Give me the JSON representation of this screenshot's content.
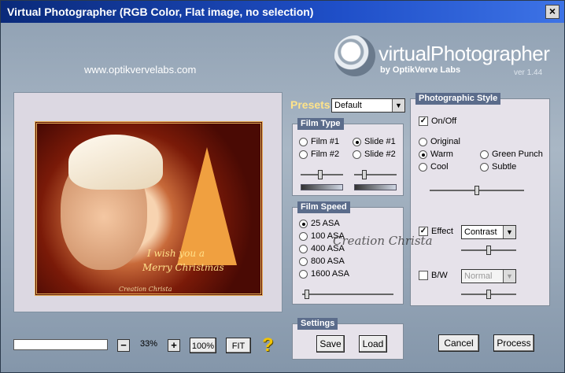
{
  "window": {
    "title": "Virtual Photographer (RGB Color, Flat image, no selection)",
    "close_label": "×"
  },
  "branding": {
    "website": "www.optikvervelabs.com",
    "logo_text": "virtualPhotographer",
    "logo_sub": "by OptikVerve Labs",
    "version": "ver 1.44"
  },
  "preview": {
    "caption_line1": "I wish you a",
    "caption_line2": "Merry Christmas",
    "credit": "Creation Christa",
    "zoom_minus": "−",
    "zoom_value": "33%",
    "zoom_plus": "+",
    "btn_100": "100%",
    "btn_fit": "FIT",
    "help": "?"
  },
  "presets": {
    "label": "Presets",
    "selected": "Default"
  },
  "film_type": {
    "title": "Film Type",
    "options": [
      {
        "label": "Film #1",
        "selected": false
      },
      {
        "label": "Slide #1",
        "selected": true
      },
      {
        "label": "Film #2",
        "selected": false
      },
      {
        "label": "Slide #2",
        "selected": false
      }
    ],
    "slider1": 0.45,
    "slider2": 0.2
  },
  "film_speed": {
    "title": "Film Speed",
    "options": [
      {
        "label": "25 ASA",
        "selected": true
      },
      {
        "label": "100 ASA",
        "selected": false
      },
      {
        "label": "400 ASA",
        "selected": false
      },
      {
        "label": "800 ASA",
        "selected": false
      },
      {
        "label": "1600 ASA",
        "selected": false
      }
    ],
    "slider": 0.03
  },
  "settings": {
    "title": "Settings",
    "save": "Save",
    "load": "Load"
  },
  "style": {
    "title": "Photographic Style",
    "onoff_label": "On/Off",
    "onoff_checked": true,
    "options": [
      {
        "label": "Original",
        "selected": false
      },
      {
        "label": "Warm",
        "selected": true
      },
      {
        "label": "Green Punch",
        "selected": false
      },
      {
        "label": "Cool",
        "selected": false
      },
      {
        "label": "Subtle",
        "selected": false
      }
    ],
    "strength_slider": 0.5,
    "effect_label": "Effect",
    "effect_checked": true,
    "effect_value": "Contrast",
    "effect_slider": 0.5,
    "bw_label": "B/W",
    "bw_checked": false,
    "bw_value": "Normal",
    "bw_slider": 0.5
  },
  "actions": {
    "cancel": "Cancel",
    "process": "Process"
  },
  "watermark": "Creation Christa"
}
